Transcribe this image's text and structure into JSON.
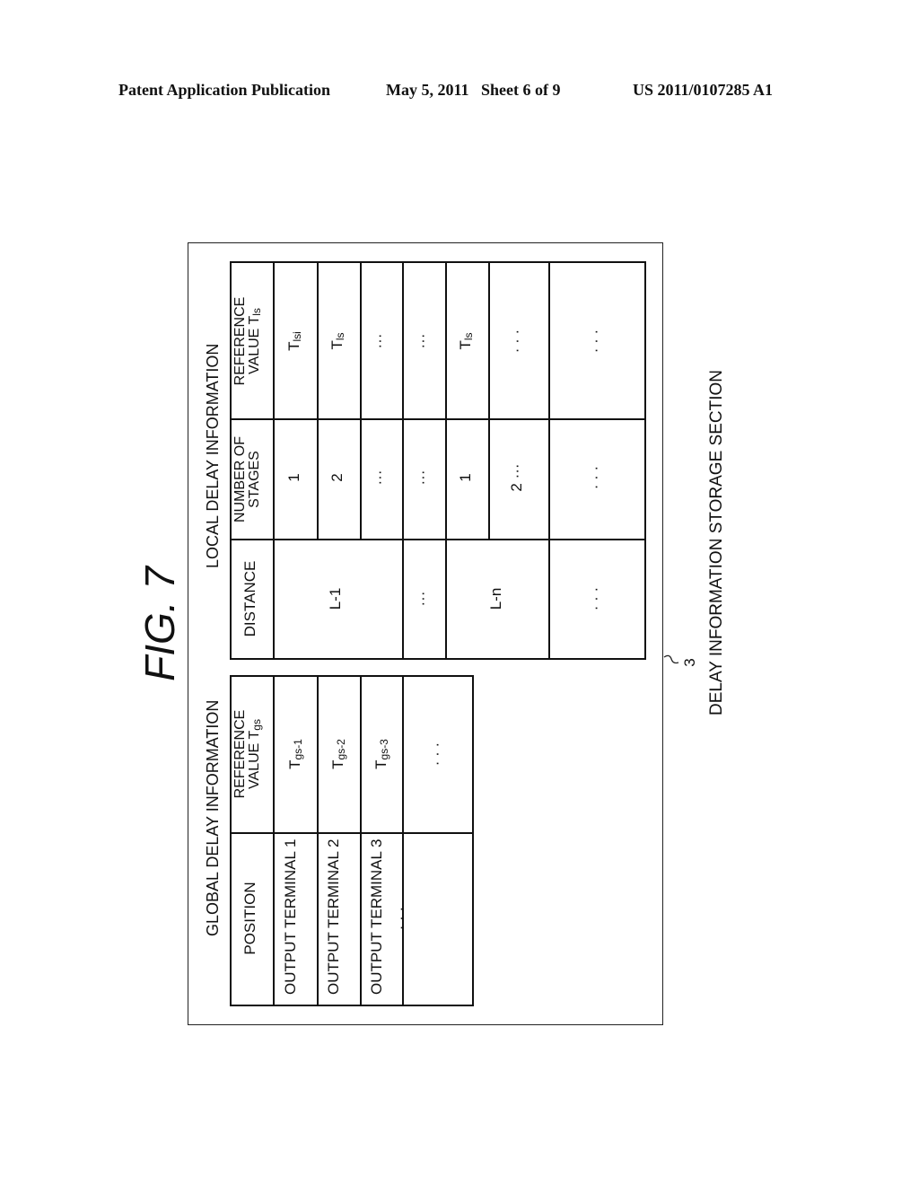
{
  "header": {
    "publication": "Patent Application Publication",
    "date_sheet": "May 5, 2011   Sheet 6 of 9",
    "patent_number": "US 2011/0107285 A1"
  },
  "figure": {
    "label": "FIG. 7",
    "reference_numeral": "3",
    "caption": "DELAY INFORMATION STORAGE SECTION"
  },
  "global_table": {
    "title": "GLOBAL DELAY INFORMATION",
    "headers": [
      "POSITION",
      "REFERENCE VALUE Tgs"
    ],
    "header2_line1": "REFERENCE",
    "header2_line2": "VALUE T",
    "header2_sub": "gs",
    "rows": [
      {
        "position": "OUTPUT TERMINAL 1",
        "value_base": "T",
        "value_sub": "gs-1"
      },
      {
        "position": "OUTPUT TERMINAL 2",
        "value_base": "T",
        "value_sub": "gs-2"
      },
      {
        "position": "OUTPUT TERMINAL 3",
        "value_base": "T",
        "value_sub": "gs-3"
      },
      {
        "position": "· · ·",
        "value_base": "· · ·",
        "value_sub": ""
      }
    ]
  },
  "local_table": {
    "title": "LOCAL DELAY INFORMATION",
    "header_distance": "DISTANCE",
    "header_stages_line1": "NUMBER OF",
    "header_stages_line2": "STAGES",
    "header_ref_line1": "REFERENCE",
    "header_ref_line2": "VALUE T",
    "header_ref_sub": "ls",
    "distances": [
      "L-1",
      "···",
      "L-n",
      "· · ·"
    ],
    "rows": [
      {
        "stages": "1",
        "value_base": "T",
        "value_sub": "lsi"
      },
      {
        "stages": "2",
        "value_base": "T",
        "value_sub": "ls"
      },
      {
        "stages": "···",
        "value_base": "···",
        "value_sub": ""
      },
      {
        "stages": "···",
        "value_base": "···",
        "value_sub": ""
      },
      {
        "stages": "1",
        "value_base": "T",
        "value_sub": "ls"
      },
      {
        "stages": "2 ···",
        "value_base": "· · ·",
        "value_sub": ""
      },
      {
        "stages": "· · ·",
        "value_base": "· · ·",
        "value_sub": ""
      }
    ]
  }
}
